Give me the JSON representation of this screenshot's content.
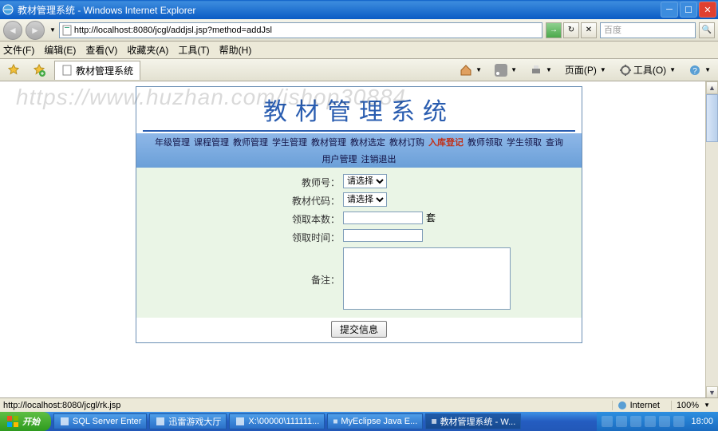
{
  "window": {
    "title": "教材管理系统 - Windows Internet Explorer",
    "url": "http://localhost:8080/jcgl/addjsl.jsp?method=addJsl",
    "search_placeholder": "百度"
  },
  "menu": {
    "file": "文件(F)",
    "edit": "编辑(E)",
    "view": "查看(V)",
    "fav": "收藏夹(A)",
    "tools": "工具(T)",
    "help": "帮助(H)"
  },
  "tab": {
    "label": "教材管理系统"
  },
  "toolbar": {
    "page": "页面(P)",
    "tools": "工具(O)"
  },
  "watermark": "https://www.huzhan.com/ishop30884",
  "app": {
    "title": "教材管理系统",
    "nav": [
      "年级管理",
      "课程管理",
      "教师管理",
      "学生管理",
      "教材管理",
      "教材选定",
      "教材订购",
      "入库登记",
      "教师领取",
      "学生领取",
      "查询",
      "用户管理",
      "注销退出"
    ],
    "nav_active_index": 7
  },
  "form": {
    "teacher_label": "教师号：",
    "teacher_placeholder": "请选择",
    "code_label": "教材代码：",
    "code_placeholder": "请选择",
    "qty_label": "领取本数：",
    "qty_value": "",
    "qty_unit": "套",
    "time_label": "领取时间：",
    "time_value": "",
    "remark_label": "备注：",
    "remark_value": "",
    "submit": "提交信息"
  },
  "status": {
    "left": "http://localhost:8080/jcgl/rk.jsp",
    "zone": "Internet",
    "zoom": "100%"
  },
  "taskbar": {
    "start": "开始",
    "items": [
      "SQL Server Enter",
      "迅雷游戏大厅",
      "X:\\00000\\111111...",
      "MyEclipse Java E...",
      "教材管理系统 - W..."
    ],
    "active_index": 4,
    "clock": "18:00"
  }
}
